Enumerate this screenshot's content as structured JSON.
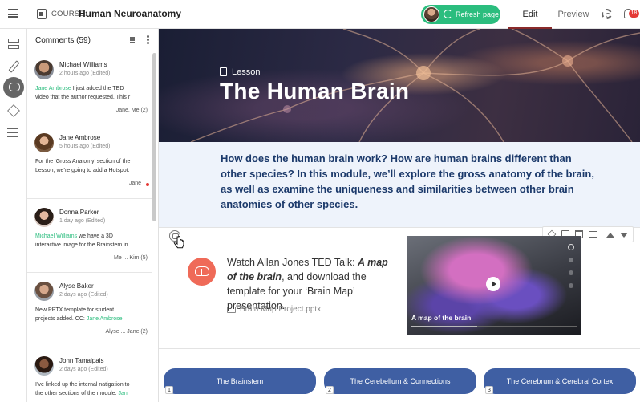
{
  "topbar": {
    "course_label": "COURSE:",
    "course_name": "Human Neuroanatomy",
    "refresh_label": "Refresh page",
    "tab_edit": "Edit",
    "tab_preview": "Preview",
    "notification_count": "18",
    "accent_color": "#2bbd7e"
  },
  "comments": {
    "title": "Comments (59)",
    "items": [
      {
        "name": "Michael Williams",
        "time": "2 hours ago (Edited)",
        "mention": "Jane Ambrose",
        "text1": " I just added the TED",
        "text2": "video that the author requested. This r",
        "footer": "Jane, Me (2)"
      },
      {
        "name": "Jane Ambrose",
        "time": "5 hours ago (Edited)",
        "text1": "For the ‘Gross Anatomy’ section of the",
        "text2": "Lesson, we’re going to add a Hotspot:",
        "footer": "Jane"
      },
      {
        "name": "Donna Parker",
        "time": "1 day ago (Edited)",
        "mention": "Michael Williams",
        "text1": " we have a 3D",
        "text2": "interactive image for the Brainstem in",
        "footer": "Me ... Kim (5)"
      },
      {
        "name": "Alyse Baker",
        "time": "2 days ago (Edited)",
        "text1": "New PPTX template for student",
        "text2_pre": "projects added. CC: ",
        "mention2": "Jane Ambrose",
        "footer": "Alyse ... Jane (2)"
      },
      {
        "name": "John Tamalpais",
        "time": "2 days ago (Edited)",
        "text1": "I’ve linked up the internal natigation to",
        "text2_pre": "the other sections of the module. ",
        "mention2": "Jan"
      }
    ]
  },
  "hero": {
    "section_label": "Lesson",
    "title": "The Human Brain"
  },
  "intro": {
    "text": "How does the human brain work? How are human brains different than other species? In this module, we’ll explore the gross anatomy of the brain, as well as examine the uniqueness and similarities between other brain anatomies of other species."
  },
  "media_block": {
    "watch_pre": "Watch Allan Jones TED Talk: ",
    "watch_em": "A map of the brain",
    "watch_post": ", and download the template for your ‘Brain Map’ presentation.",
    "file_name": "Brain Map Project.pptx",
    "video_title": "A map of the brain"
  },
  "nav_buttons": [
    {
      "label": "The Brainstem",
      "num": "1"
    },
    {
      "label": "The Cerebellum & Connections",
      "num": "2"
    },
    {
      "label": "The Cerebrum & Cerebral Cortex",
      "num": "3"
    }
  ]
}
